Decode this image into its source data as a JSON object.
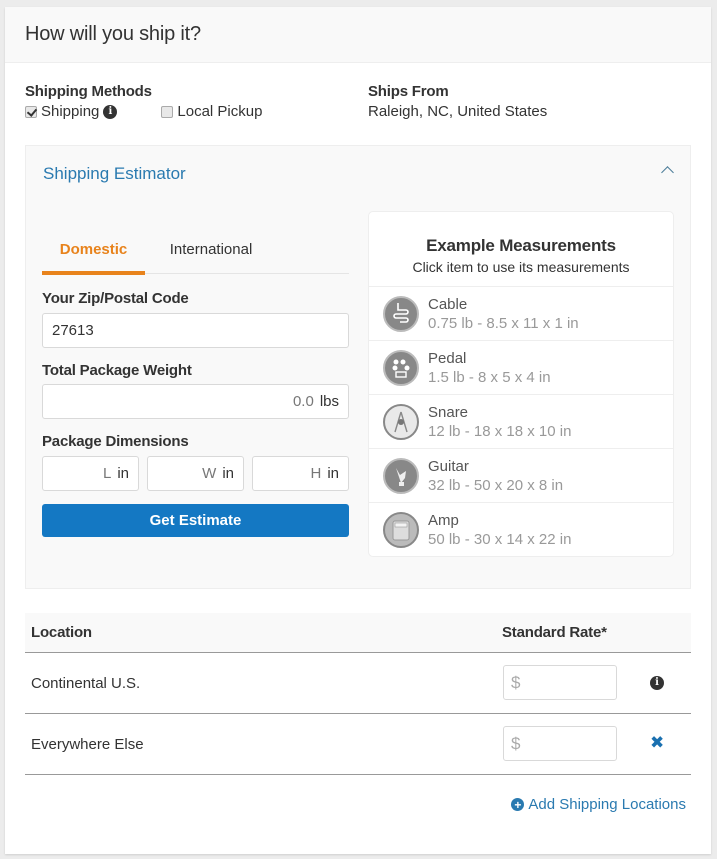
{
  "header": {
    "title": "How will you ship it?"
  },
  "shipping_methods": {
    "label": "Shipping Methods",
    "options": [
      {
        "label": "Shipping",
        "checked": true,
        "has_info": true
      },
      {
        "label": "Local Pickup",
        "checked": false
      }
    ]
  },
  "ships_from": {
    "label": "Ships From",
    "value": "Raleigh, NC, United States"
  },
  "estimator": {
    "title": "Shipping Estimator",
    "tabs": [
      {
        "label": "Domestic",
        "active": true
      },
      {
        "label": "International",
        "active": false
      }
    ],
    "zip": {
      "label": "Your Zip/Postal Code",
      "value": "27613"
    },
    "weight": {
      "label": "Total Package Weight",
      "value": "0.0",
      "unit": "lbs"
    },
    "dimensions": {
      "label": "Package Dimensions",
      "fields": [
        {
          "placeholder": "L",
          "unit": "in"
        },
        {
          "placeholder": "W",
          "unit": "in"
        },
        {
          "placeholder": "H",
          "unit": "in"
        }
      ]
    },
    "button": "Get Estimate",
    "examples": {
      "title": "Example Measurements",
      "subtitle": "Click item to use its measurements",
      "items": [
        {
          "name": "Cable",
          "measurements": "0.75 lb - 8.5 x 11 x 1 in",
          "icon": "cable-icon"
        },
        {
          "name": "Pedal",
          "measurements": "1.5 lb - 8 x 5 x 4 in",
          "icon": "pedal-icon"
        },
        {
          "name": "Snare",
          "measurements": "12 lb - 18 x 18 x 10 in",
          "icon": "snare-icon"
        },
        {
          "name": "Guitar",
          "measurements": "32 lb - 50 x 20 x 8 in",
          "icon": "guitar-icon"
        },
        {
          "name": "Amp",
          "measurements": "50 lb - 30 x 14 x 22 in",
          "icon": "amp-icon"
        }
      ]
    }
  },
  "rates": {
    "columns": {
      "location": "Location",
      "rate": "Standard Rate*"
    },
    "rows": [
      {
        "location": "Continental U.S.",
        "currency": "$",
        "value": "",
        "action": "info-icon"
      },
      {
        "location": "Everywhere Else",
        "currency": "$",
        "value": "",
        "action": "close-icon"
      }
    ],
    "add_link": "Add Shipping Locations"
  },
  "colors": {
    "accent_orange": "#e8831c",
    "primary_blue": "#1478c3",
    "link_blue": "#2a7ab0"
  }
}
